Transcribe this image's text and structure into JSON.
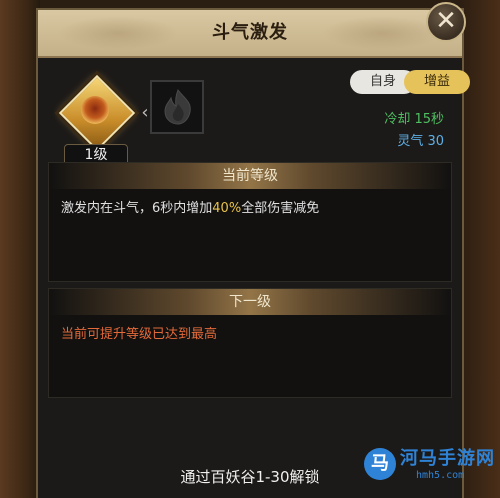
{
  "dialog": {
    "title": "斗气激发",
    "close_symbol": "✕"
  },
  "skill": {
    "level": "1级",
    "arrow": "‹",
    "tags": {
      "self": "自身",
      "buff": "增益"
    },
    "cooldown": "冷却  15秒",
    "spirit": "灵气  30"
  },
  "current_level": {
    "header": "当前等级",
    "text_before": "激发内在斗气，6秒内增加",
    "text_highlight": "40%",
    "text_after": "全部伤害减免"
  },
  "next_level": {
    "header": "下一级",
    "text": "当前可提升等级已达到最高"
  },
  "unlock": "通过百妖谷1-30解锁",
  "watermark": {
    "title": "河马手游网",
    "url": "hmh5.com",
    "logo_char": "马"
  },
  "colors": {
    "cooldown": "#4fbf62",
    "spirit": "#5fb0e6",
    "highlight": "#e8c24a",
    "max_level": "#e36a3a",
    "buff_tag": "#e6c35a"
  }
}
